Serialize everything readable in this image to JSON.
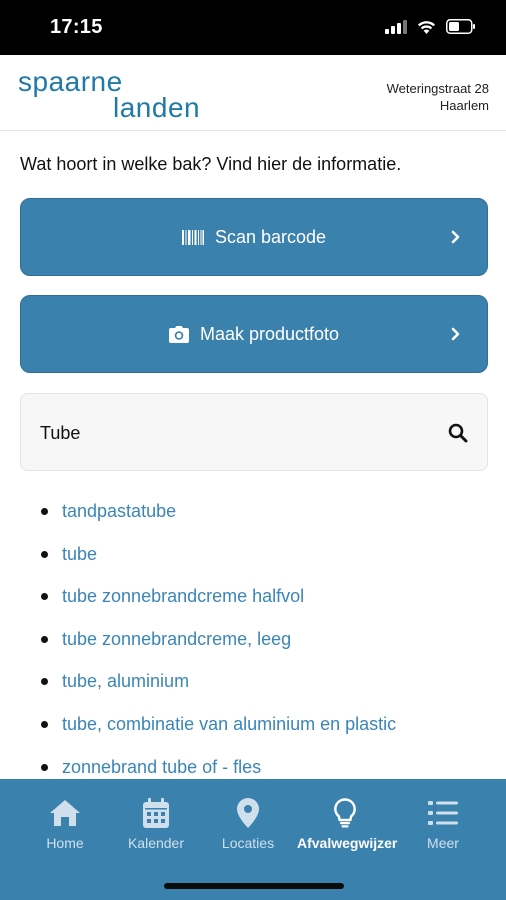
{
  "status": {
    "time": "17:15"
  },
  "header": {
    "logo_line1": "spaarne",
    "logo_line2": "landen",
    "address_line1": "Weteringstraat 28",
    "address_line2": "Haarlem",
    "brand_color": "#1f7aa8"
  },
  "intro": "Wat hoort in welke bak? Vind hier de informatie.",
  "buttons": {
    "scan_label": "Scan barcode",
    "photo_label": "Maak productfoto",
    "color": "#3b81ad"
  },
  "search": {
    "value": "Tube"
  },
  "results": [
    "tandpastatube",
    "tube",
    "tube zonnebrandcreme halfvol",
    "tube zonnebrandcreme, leeg",
    "tube, aluminium",
    "tube, combinatie van aluminium en plastic",
    "zonnebrand tube of - fles"
  ],
  "nav": {
    "items": [
      {
        "label": "Home",
        "icon": "home-icon"
      },
      {
        "label": "Kalender",
        "icon": "calendar-icon"
      },
      {
        "label": "Locaties",
        "icon": "map-pin-icon"
      },
      {
        "label": "Afvalwegwijzer",
        "icon": "lightbulb-icon",
        "active": true
      },
      {
        "label": "Meer",
        "icon": "list-icon"
      }
    ]
  }
}
